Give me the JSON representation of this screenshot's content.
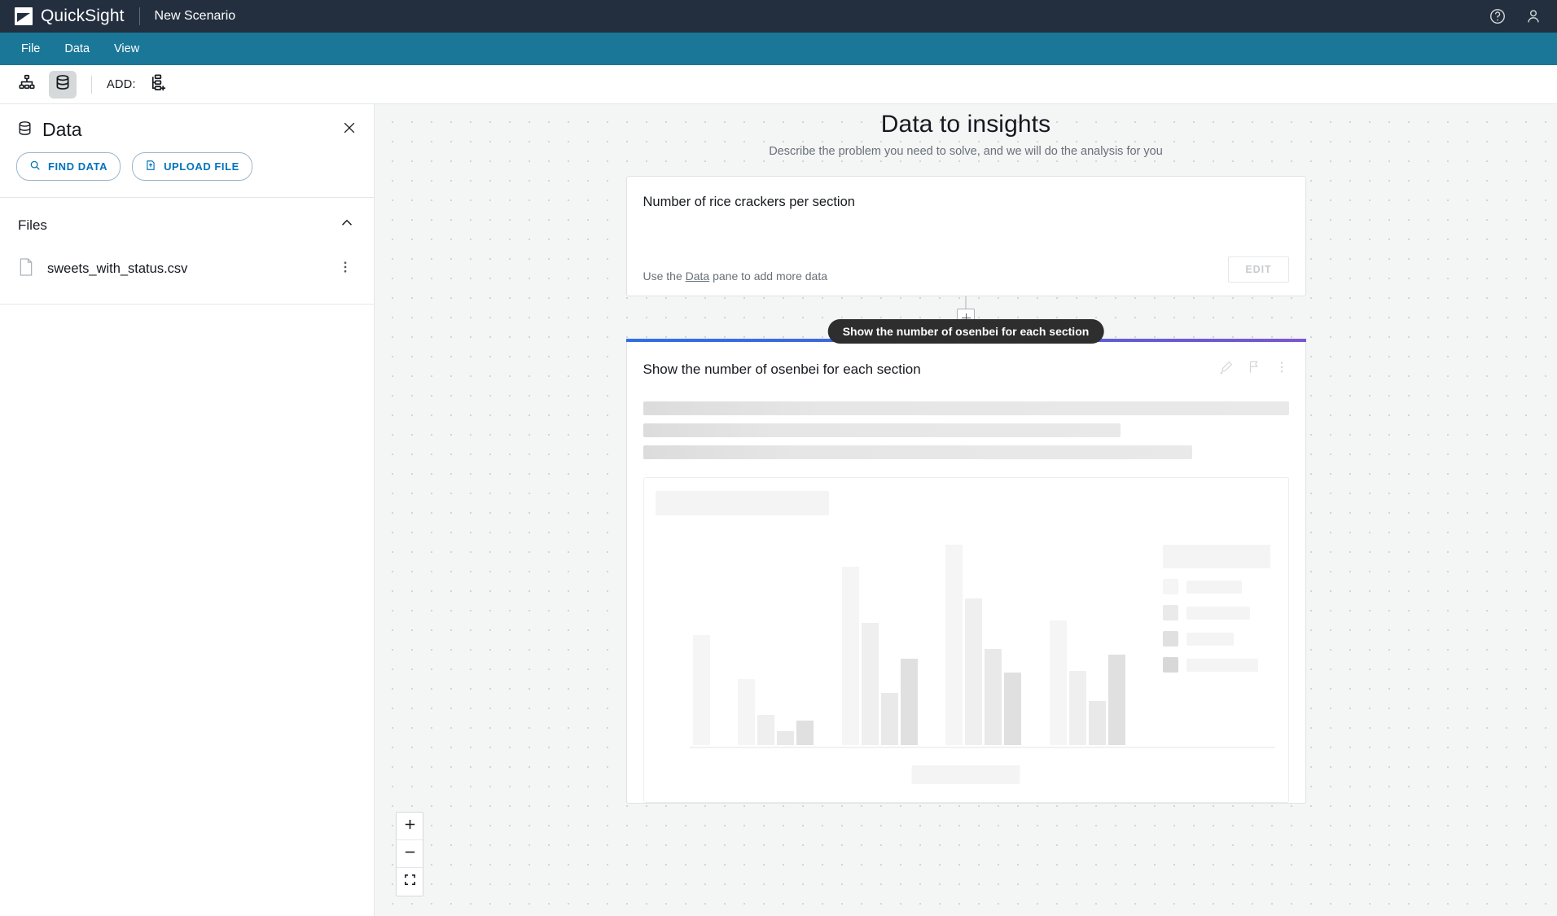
{
  "topbar": {
    "product_name": "QuickSight",
    "scenario_title": "New Scenario",
    "help_icon": "help-circle-icon",
    "account_icon": "user-account-icon"
  },
  "menubar": {
    "items": [
      {
        "label": "File"
      },
      {
        "label": "Data"
      },
      {
        "label": "View"
      }
    ]
  },
  "toolbar": {
    "hierarchy_icon": "hierarchy-icon",
    "dataset_icon": "database-icon",
    "add_label": "ADD:",
    "add_node_icon": "add-node-icon"
  },
  "sidebar": {
    "title": "Data",
    "title_icon": "database-icon",
    "close_icon": "close-icon",
    "buttons": [
      {
        "label": "FIND DATA",
        "icon": "search-icon"
      },
      {
        "label": "UPLOAD FILE",
        "icon": "upload-file-icon"
      }
    ],
    "sections": [
      {
        "label": "Files",
        "collapse_icon": "chevron-up-icon",
        "files": [
          {
            "name": "sweets_with_status.csv",
            "icon": "file-icon",
            "menu_icon": "more-vertical-icon"
          }
        ]
      }
    ]
  },
  "canvas": {
    "title": "Data to insights",
    "subtitle": "Describe the problem you need to solve, and we will do the analysis for you",
    "zoom_controls": [
      {
        "name": "zoom-in",
        "icon": "plus-icon"
      },
      {
        "name": "zoom-out",
        "icon": "minus-icon"
      },
      {
        "name": "fit-to-screen",
        "icon": "expand-icon"
      }
    ]
  },
  "card_data_source": {
    "title": "Number of rice crackers per section",
    "hint_prefix": "Use the ",
    "hint_link": "Data",
    "hint_suffix": " pane to add more data",
    "edit_label": "EDIT"
  },
  "connector": {
    "add_icon": "plus-icon",
    "tooltip": "Show the number of osenbei for each section"
  },
  "card_analysis": {
    "title": "Show the number of osenbei for each section",
    "accent_from": "#2f6fe4",
    "accent_to": "#7a57d1",
    "icons": [
      {
        "name": "edit-pencil-add-icon"
      },
      {
        "name": "flag-icon"
      },
      {
        "name": "more-vertical-icon"
      }
    ],
    "loading": true
  },
  "chart_data": {
    "type": "bar",
    "title": "",
    "xlabel": "",
    "ylabel": "",
    "state": "loading-skeleton",
    "groups": [
      {
        "values": [
          62
        ]
      },
      {
        "values": [
          37,
          17,
          8,
          14
        ]
      },
      {
        "values": [
          100,
          68,
          29,
          48
        ]
      },
      {
        "values": [
          112,
          82,
          54,
          40
        ]
      },
      {
        "values": [
          69,
          41,
          25,
          50
        ]
      }
    ],
    "bar_colors": [
      "#f5f5f5",
      "#efefef",
      "#e9e9e9",
      "#e0e0e0"
    ],
    "legend": {
      "position": "right",
      "items": [
        {
          "swatch": "#f5f5f5"
        },
        {
          "swatch": "#eaeaea"
        },
        {
          "swatch": "#e0e0e0"
        },
        {
          "swatch": "#d8d8d8"
        }
      ]
    },
    "skeleton_line_widths": [
      "100%",
      "74%",
      "85%"
    ],
    "legend_label_widths": [
      68,
      78,
      58,
      88
    ]
  }
}
